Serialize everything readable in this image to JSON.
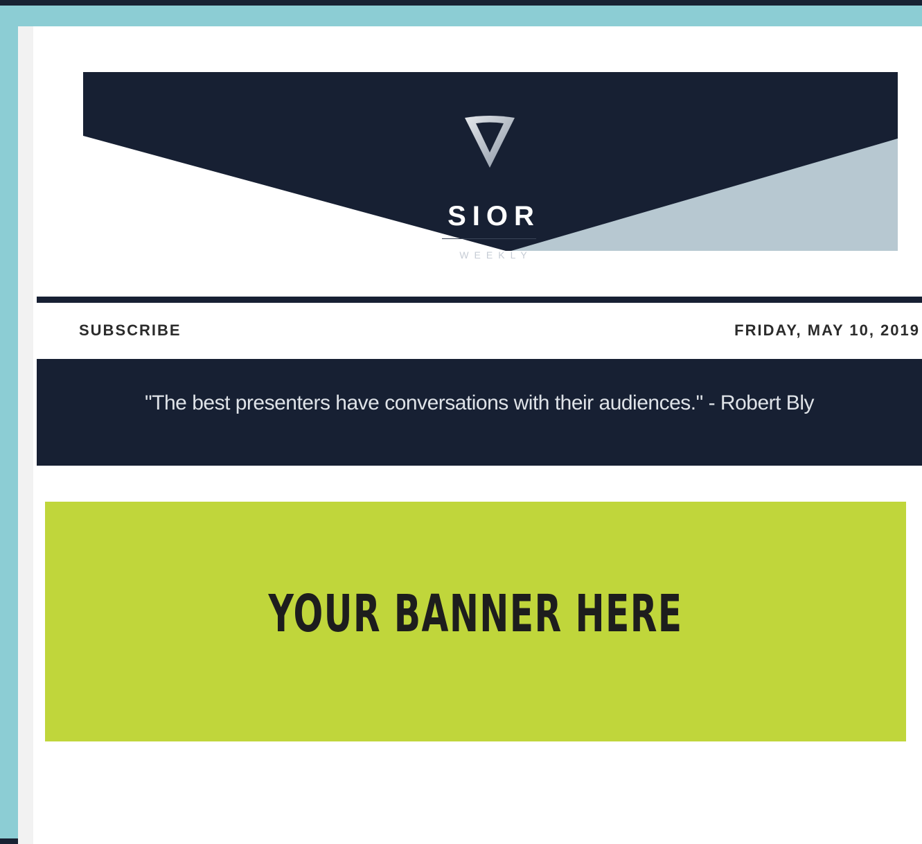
{
  "newsletter": {
    "logo_name": "SIOR",
    "logo_sub": "WEEKLY",
    "subscribe_label": "SUBSCRIBE",
    "date": "FRIDAY, MAY 10, 2019",
    "quote": "\"The best presenters have conversations with their audiences.\" - Robert Bly"
  },
  "banner": {
    "text": "YOUR BANNER HERE"
  },
  "colors": {
    "navy": "#172033",
    "light_blue_gray": "#b7c8d1",
    "frame_teal": "#8ccdd4",
    "banner_lime": "#c0d63b"
  },
  "icons": {
    "logo": "shield-v-logo-icon"
  }
}
